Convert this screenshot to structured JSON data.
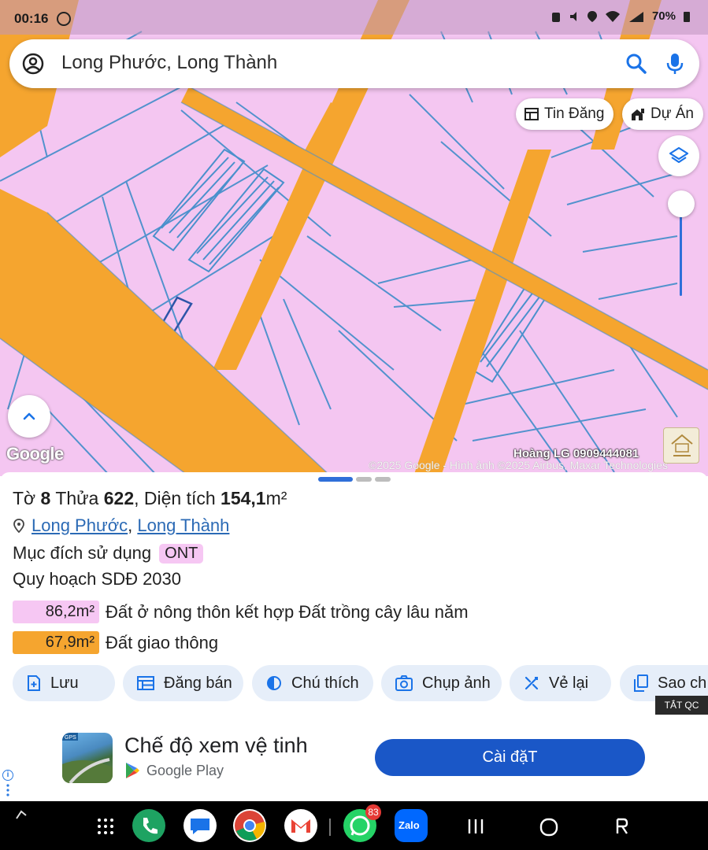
{
  "status_bar": {
    "time": "00:16",
    "battery": "70%"
  },
  "search": {
    "query": "Long Phước, Long Thành"
  },
  "map": {
    "chips": [
      {
        "label": "Tin Đăng"
      },
      {
        "label": "Dự Án"
      }
    ],
    "google_logo": "Google",
    "watermark": "Hoàng LG 0909444081",
    "copyright": "©2025 Google - Hình ảnh ©2025 Airbus, Maxar Technologies",
    "colors": {
      "parcel": "#f4c6f1",
      "road": "#f5a52f",
      "boundary": "#3f86c6"
    }
  },
  "parcel": {
    "sheet_label": "Tờ",
    "sheet_number": "8",
    "lot_label": "Thửa",
    "lot_number": "622",
    "area_label": ", Diện tích",
    "area_value": "154,1",
    "area_unit": "m²",
    "location": {
      "commune": "Long Phước",
      "district": "Long Thành",
      "separator": ", "
    },
    "purpose_label": "Mục đích sử dụng",
    "purpose_code": "ONT",
    "plan_title": "Quy hoạch SDĐ 2030",
    "plan_rows": [
      {
        "area": "86,2m²",
        "label": "Đất ở nông thôn kết hợp Đất trồng cây lâu năm",
        "color": "#f6c7f3"
      },
      {
        "area": "67,9m²",
        "label": "Đất giao thông",
        "color": "#f5a52f"
      }
    ]
  },
  "actions": [
    {
      "label": "Lưu",
      "icon": "save-add-icon"
    },
    {
      "label": "Đăng bán",
      "icon": "listing-icon"
    },
    {
      "label": "Chú thích",
      "icon": "contrast-icon"
    },
    {
      "label": "Chụp ảnh",
      "icon": "camera-icon"
    },
    {
      "label": "Vẻ lại",
      "icon": "redraw-icon"
    },
    {
      "label": "Sao ch",
      "icon": "copy-icon"
    }
  ],
  "ad": {
    "close_label": "TẮT QC",
    "title": "Chế độ xem vệ tinh",
    "store": "Google Play",
    "cta": "Cài đặT",
    "icon_badge": "GPS"
  },
  "nav": {
    "whatsapp_badge": "83",
    "zalo_label": "Zalo"
  }
}
